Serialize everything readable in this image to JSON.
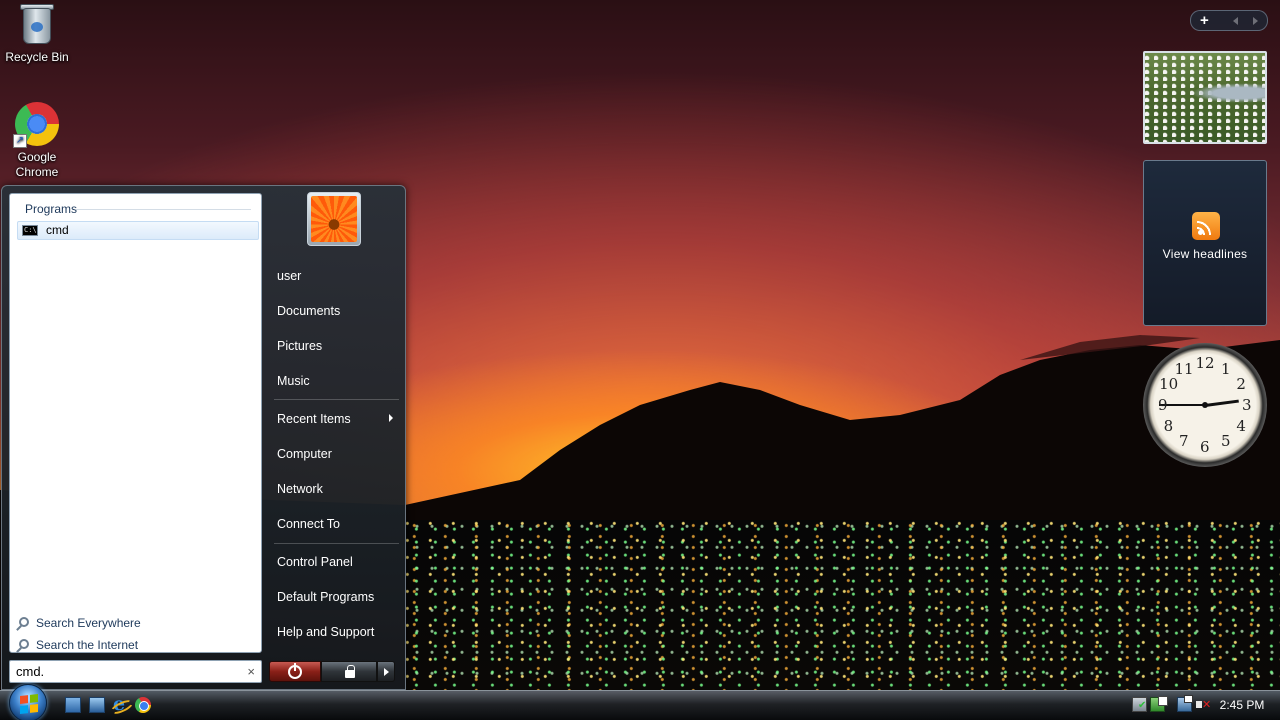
{
  "desktop": {
    "icons": [
      {
        "label": "Recycle Bin",
        "icon": "recycle-bin-icon"
      },
      {
        "label": "Google Chrome",
        "icon": "chrome-icon"
      }
    ]
  },
  "start_menu": {
    "left_pane": {
      "programs_header": "Programs",
      "results": [
        {
          "label": "cmd",
          "icon": "cmd-icon",
          "icon_text": "C:\\"
        }
      ],
      "search_links": [
        {
          "label": "Search Everywhere",
          "icon": "search-icon"
        },
        {
          "label": "Search the Internet",
          "icon": "search-icon"
        }
      ]
    },
    "search": {
      "value": "cmd.",
      "clear_glyph": "×"
    },
    "right_pane": {
      "items": [
        {
          "label": "user"
        },
        {
          "label": "Documents"
        },
        {
          "label": "Pictures"
        },
        {
          "label": "Music"
        },
        {
          "label": "Recent Items",
          "has_submenu": true
        },
        {
          "label": "Computer"
        },
        {
          "label": "Network"
        },
        {
          "label": "Connect To"
        },
        {
          "label": "Control Panel"
        },
        {
          "label": "Default Programs"
        },
        {
          "label": "Help and Support"
        }
      ]
    },
    "power_buttons": [
      {
        "icon": "power-icon"
      },
      {
        "icon": "lock-icon"
      },
      {
        "icon": "chevron-right-icon"
      }
    ]
  },
  "sidebar": {
    "controls": {
      "add_glyph": "+"
    },
    "headlines": {
      "label": "View headlines",
      "icon": "rss-icon"
    },
    "clock": {
      "numbers": [
        "12",
        "1",
        "2",
        "3",
        "4",
        "5",
        "6",
        "7",
        "8",
        "9",
        "10",
        "11"
      ],
      "hour": 2,
      "minute": 45
    }
  },
  "taskbar": {
    "quick_launch": [
      "show-desktop-icon",
      "switch-windows-icon",
      "internet-explorer-icon",
      "chrome-icon"
    ],
    "tray": [
      "windows-defender-icon",
      "update-icon",
      "network-icon",
      "volume-muted-icon"
    ],
    "time": "2:45 PM"
  },
  "colors": {
    "accent": "#3b7fc9",
    "power_red": "#8a2018",
    "selection_border": "#c5dcf3"
  }
}
